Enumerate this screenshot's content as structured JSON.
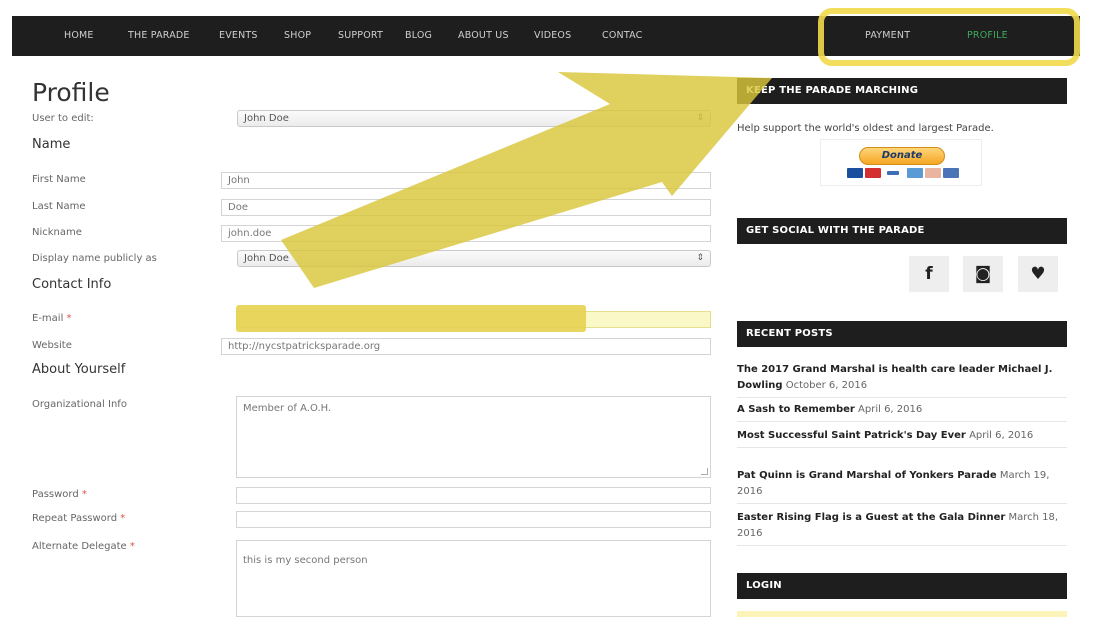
{
  "nav": {
    "items": [
      {
        "label": "HOME"
      },
      {
        "label": "THE PARADE"
      },
      {
        "label": "EVENTS"
      },
      {
        "label": "SHOP"
      },
      {
        "label": "SUPPORT"
      },
      {
        "label": "BLOG"
      },
      {
        "label": "ABOUT US"
      },
      {
        "label": "VIDEOS"
      },
      {
        "label": "CONTAC"
      },
      {
        "label": "PAYMENT"
      },
      {
        "label": "PROFILE"
      }
    ],
    "active_color": "#3daa5a"
  },
  "form": {
    "title": "Profile",
    "user_to_edit_label": "User to edit:",
    "user_to_edit_value": "John Doe",
    "name_heading": "Name",
    "first_name_label": "First Name",
    "first_name_value": "John",
    "last_name_label": "Last Name",
    "last_name_value": "Doe",
    "nickname_label": "Nickname",
    "nickname_value": "john.doe",
    "display_name_label": "Display name publicly as",
    "display_name_value": "John Doe",
    "contact_heading": "Contact Info",
    "email_label": "E-mail",
    "email_value": "",
    "website_label": "Website",
    "website_value": "http://nycstpatricksparade.org",
    "about_heading": "About Yourself",
    "org_info_label": "Organizational Info",
    "org_info_value": "Member of A.O.H.",
    "password_label": "Password",
    "repeat_password_label": "Repeat Password",
    "alternate_delegate_label": "Alternate Delegate",
    "alternate_delegate_value": "this is my second person",
    "required_mark": "*"
  },
  "sidebar": {
    "support_heading": "KEEP THE PARADE MARCHING",
    "support_text": "Help support the world's oldest and largest Parade.",
    "donate_label": "Donate",
    "social_heading": "GET SOCIAL WITH THE PARADE",
    "social": [
      {
        "glyph": "f",
        "icon": "facebook-icon"
      },
      {
        "glyph": "◙",
        "icon": "instagram-icon"
      },
      {
        "glyph": "♥",
        "icon": "twitter-icon"
      }
    ],
    "recent_heading": "RECENT POSTS",
    "posts": [
      {
        "title": "The 2017 Grand Marshal is health care leader Michael J. Dowling",
        "date": "October 6, 2016"
      },
      {
        "title": "A Sash to Remember",
        "date": "April 6, 2016"
      },
      {
        "title": "Most Successful Saint Patrick's Day Ever",
        "date": "April 6, 2016"
      },
      {
        "title": "Pat Quinn is Grand Marshal of Yonkers Parade",
        "date": "March 19, 2016"
      },
      {
        "title": "Easter Rising Flag is a Guest at the Gala Dinner",
        "date": "March 18, 2016"
      }
    ],
    "login_heading": "LOGIN"
  },
  "colors": {
    "annotation_yellow": "#f2d94a",
    "nav_background": "#1e1e1e"
  }
}
